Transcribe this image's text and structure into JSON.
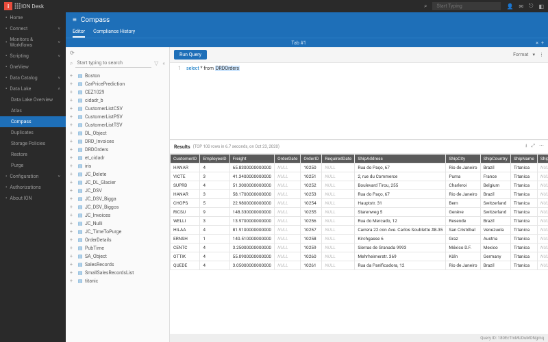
{
  "header": {
    "app_name": "ION Desk",
    "search_placeholder": "Start Typing"
  },
  "sidebar": {
    "items": [
      {
        "label": "Home",
        "icon": "home"
      },
      {
        "label": "Connect",
        "icon": "link",
        "chev": true
      },
      {
        "label": "Monitors & Workflows",
        "icon": "monitor",
        "chev": true
      },
      {
        "label": "Scripting",
        "icon": "code",
        "chev": true
      },
      {
        "label": "OneView",
        "icon": "eye"
      },
      {
        "label": "Data Catalog",
        "icon": "db",
        "chev": true
      },
      {
        "label": "Data Lake",
        "icon": "layers",
        "chev": true,
        "open": true
      }
    ],
    "datalake_sub": [
      {
        "label": "Data Lake Overview"
      },
      {
        "label": "Atlas"
      },
      {
        "label": "Compass",
        "active": true
      },
      {
        "label": "Duplicates"
      },
      {
        "label": "Storage Policies"
      },
      {
        "label": "Restore"
      },
      {
        "label": "Purge"
      }
    ],
    "bottom": [
      {
        "label": "Configuration",
        "icon": "gear",
        "chev": true
      },
      {
        "label": "Authorizations",
        "icon": "lock"
      },
      {
        "label": "About ION",
        "icon": "info"
      }
    ]
  },
  "compass": {
    "title": "Compass",
    "tabs": [
      {
        "label": "Editor",
        "active": true
      },
      {
        "label": "Compliance History"
      }
    ],
    "open_tab": "Tab #1"
  },
  "explorer": {
    "search_placeholder": "Start typing to search",
    "files": [
      "Boston",
      "CarPricePrediction",
      "CEZ1029",
      "cidadr_b",
      "CustomerListCSV",
      "CustomerListPSV",
      "CustomerListTSV",
      "DL_Object",
      "DRD_Invoices",
      "DRDOrders",
      "et_cidadr",
      "iris",
      "JC_Delete",
      "JC_DL_Glacier",
      "JC_DSV",
      "JC_DSV_Bigga",
      "JC_DSV_Biggos",
      "JC_Invoices",
      "JC_Nulli",
      "JC_TimeToPurge",
      "OrderDetails",
      "PubTime",
      "SA_Object",
      "SalesRecords",
      "SmallSalesRecordsList",
      "titanic"
    ]
  },
  "editor": {
    "run_label": "Run Query",
    "format_label": "Format",
    "sql_keyword": "select",
    "sql_rest": " * from ",
    "sql_table": "DRDOrders"
  },
  "results": {
    "title": "Results",
    "meta": "(TOP 100 rows in 6.7 seconds, on Oct 23, 2020)",
    "columns": [
      "CustomerID",
      "EmployeeID",
      "Freight",
      "OrderDate",
      "OrderID",
      "RequiredDate",
      "ShipAddress",
      "ShipCity",
      "ShipCountry",
      "ShipName",
      "ShippedDate"
    ],
    "rows": [
      [
        "HANAR",
        "4",
        "65.8300000000000",
        "NULL",
        "10250",
        "NULL",
        "Rua do Paço, 67",
        "Rio de Janeiro",
        "Brazil",
        "Titanica",
        "NULL"
      ],
      [
        "VICTE",
        "3",
        "41.3400000000000",
        "NULL",
        "10251",
        "NULL",
        "2, rue du Commerce",
        "Puma",
        "France",
        "Titanica",
        "NULL"
      ],
      [
        "SUPRD",
        "4",
        "51.3000000000000",
        "NULL",
        "10252",
        "NULL",
        "Boulevard Tirou, 255",
        "Charleroi",
        "Belgium",
        "Titanica",
        "NULL"
      ],
      [
        "HANAR",
        "3",
        "58.1700000000000",
        "NULL",
        "10253",
        "NULL",
        "Rua do Paço, 67",
        "Rio de Janeiro",
        "Brazil",
        "Titanica",
        "NULL"
      ],
      [
        "CHOPS",
        "5",
        "22.9800000000000",
        "NULL",
        "10254",
        "NULL",
        "Hauptstr. 31",
        "Bern",
        "Switzerland",
        "Titanica",
        "NULL"
      ],
      [
        "RICSU",
        "9",
        "148.330000000000",
        "NULL",
        "10255",
        "NULL",
        "Starenweg 5",
        "Genève",
        "Switzerland",
        "Titanica",
        "NULL"
      ],
      [
        "WELLI",
        "3",
        "13.9700000000000",
        "NULL",
        "10256",
        "NULL",
        "Rua do Mercado, 12",
        "Resende",
        "Brazil",
        "Titanica",
        "NULL"
      ],
      [
        "HILAA",
        "4",
        "81.9100000000000",
        "NULL",
        "10257",
        "NULL",
        "Carrera 22 con Ave. Carlos Soublette #8-35",
        "San Cristóbal",
        "Venezuela",
        "Titanica",
        "NULL"
      ],
      [
        "ERNSH",
        "1",
        "140.510000000000",
        "NULL",
        "10258",
        "NULL",
        "Kirchgasse 6",
        "Graz",
        "Austria",
        "Titanica",
        "NULL"
      ],
      [
        "CENTC",
        "4",
        "3.25000000000000",
        "NULL",
        "10259",
        "NULL",
        "Sierras de Granada 9993",
        "México D.F.",
        "Mexico",
        "Titanica",
        "NULL"
      ],
      [
        "OTTIK",
        "4",
        "55.0900000000000",
        "NULL",
        "10260",
        "NULL",
        "Mehrheimerstr. 369",
        "Köln",
        "Germany",
        "Titanica",
        "NULL"
      ],
      [
        "QUEDE",
        "4",
        "3.05000000000000",
        "NULL",
        "10261",
        "NULL",
        "Rua da Panificadora, 12",
        "Rio de Janeiro",
        "Brazil",
        "Titanica",
        "NULL"
      ]
    ]
  },
  "footer": {
    "text": "Query ID: 180EcTmMUDuMONgmq"
  }
}
